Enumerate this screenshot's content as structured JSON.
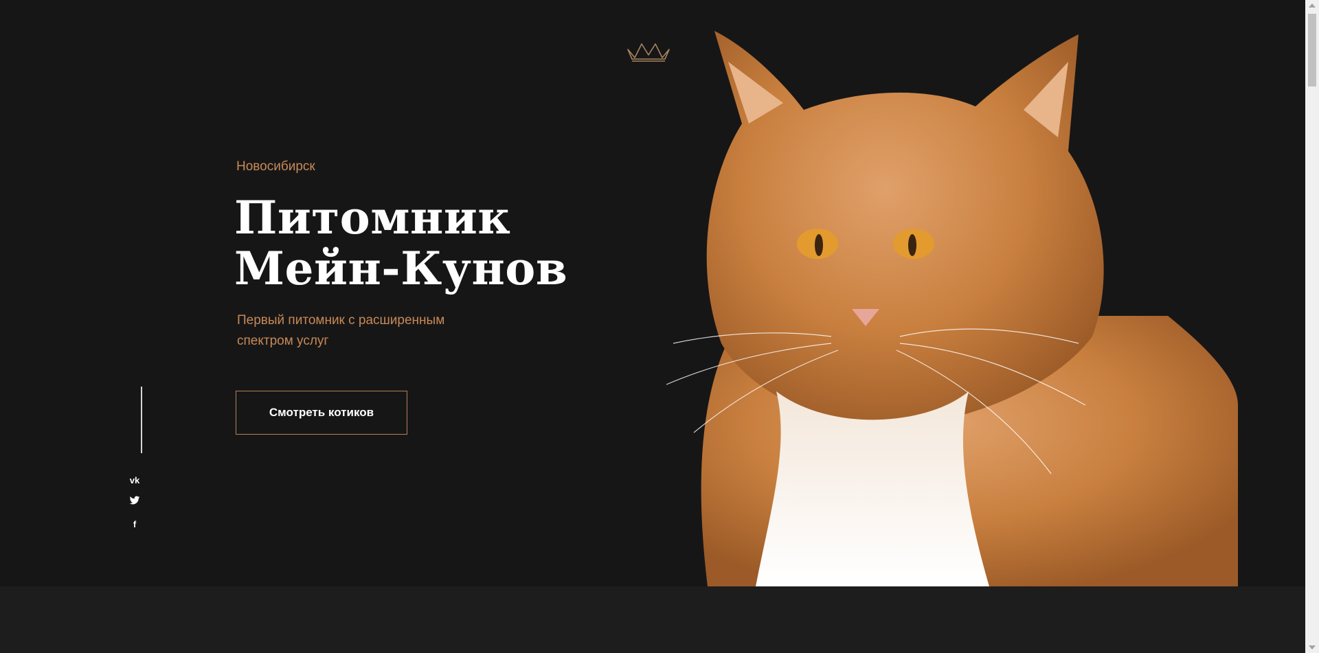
{
  "hero": {
    "city": "Новосибирск",
    "title_line1": "Питомник",
    "title_line2": "Мейн-Кунов",
    "subtitle": "Первый питомник с расширенным спектром услуг",
    "cta_label": "Смотреть котиков"
  },
  "social": {
    "items": [
      {
        "icon": "vk-icon",
        "glyph": "vk"
      },
      {
        "icon": "twitter-icon",
        "glyph": "🐦"
      },
      {
        "icon": "facebook-icon",
        "glyph": "f"
      }
    ]
  },
  "colors": {
    "background": "#171617",
    "accent": "#c68a56",
    "below_section": "#1e1d1e",
    "button_border": "#b0825a",
    "text": "#ffffff"
  },
  "images": {
    "logo": "crown-icon",
    "hero_image": "maine-coon-cat-photo"
  }
}
